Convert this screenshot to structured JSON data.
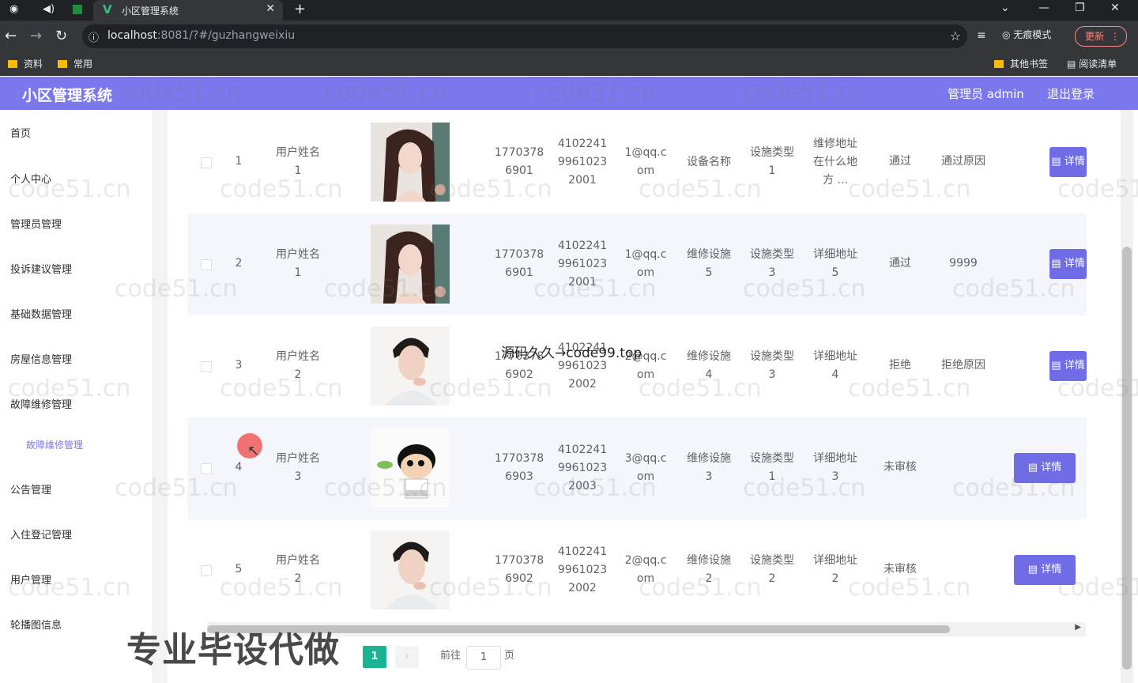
{
  "browser": {
    "tab_title": "小区管理系统",
    "url_host": "localhost",
    "url_path": ":8081/?#/guzhangweixiu",
    "incognito_label": "无痕模式",
    "update_label": "更新",
    "bookmarks": [
      {
        "label": "资料"
      },
      {
        "label": "常用"
      },
      {
        "label": "其他书签"
      },
      {
        "label": "阅读清单"
      }
    ]
  },
  "header": {
    "title": "小区管理系统",
    "user": "管理员 admin",
    "logout": "退出登录",
    "accent_color": "#7b78ee"
  },
  "sidebar": {
    "items": [
      {
        "label": "首页"
      },
      {
        "label": "个人中心"
      },
      {
        "label": "管理员管理"
      },
      {
        "label": "投诉建议管理"
      },
      {
        "label": "基础数据管理"
      },
      {
        "label": "房屋信息管理"
      },
      {
        "label": "故障维修管理"
      },
      {
        "label": "故障维修管理",
        "sub": true,
        "active": true
      },
      {
        "label": "公告管理"
      },
      {
        "label": "入住登记管理"
      },
      {
        "label": "用户管理"
      },
      {
        "label": "轮播图信息"
      }
    ]
  },
  "table": {
    "rows": [
      {
        "index": "1",
        "user_name": [
          "用户姓名",
          "1"
        ],
        "photo": "female-avatar",
        "phone": [
          "1770378",
          "6901"
        ],
        "id_card": [
          "4102241",
          "9961023",
          "2001"
        ],
        "email": [
          "1@qq.c",
          "om"
        ],
        "facility": [
          "设备名称"
        ],
        "facility_type": [
          "设施类型",
          "1"
        ],
        "address": [
          "维修地址",
          "在什么地",
          "方 ..."
        ],
        "status": "通过",
        "reason": "通过原因",
        "action": "详情"
      },
      {
        "index": "2",
        "user_name": [
          "用户姓名",
          "1"
        ],
        "photo": "female-avatar",
        "phone": [
          "1770378",
          "6901"
        ],
        "id_card": [
          "4102241",
          "9961023",
          "2001"
        ],
        "email": [
          "1@qq.c",
          "om"
        ],
        "facility": [
          "维修设施",
          "5"
        ],
        "facility_type": [
          "设施类型",
          "3"
        ],
        "address": [
          "详细地址",
          "5"
        ],
        "status": "通过",
        "reason": "9999",
        "action": "详情"
      },
      {
        "index": "3",
        "user_name": [
          "用户姓名",
          "2"
        ],
        "photo": "male-avatar",
        "phone": [
          "1770378",
          "6902"
        ],
        "id_card": [
          "4102241",
          "9961023",
          "2002"
        ],
        "email": [
          "2@qq.c",
          "om"
        ],
        "facility": [
          "维修设施",
          "4"
        ],
        "facility_type": [
          "设施类型",
          "3"
        ],
        "address": [
          "详细地址",
          "4"
        ],
        "status": "拒绝",
        "reason": "拒绝原因",
        "action": "详情"
      },
      {
        "index": "4",
        "user_name": [
          "用户姓名",
          "3"
        ],
        "photo": "cartoon-avatar",
        "phone": [
          "1770378",
          "6903"
        ],
        "id_card": [
          "4102241",
          "9961023",
          "2003"
        ],
        "email": [
          "3@qq.c",
          "om"
        ],
        "facility": [
          "维修设施",
          "3"
        ],
        "facility_type": [
          "设施类型",
          "1"
        ],
        "address": [
          "详细地址",
          "3"
        ],
        "status": "未审核",
        "reason": "",
        "action": "详情"
      },
      {
        "index": "5",
        "user_name": [
          "用户姓名",
          "2"
        ],
        "photo": "male-avatar",
        "phone": [
          "1770378",
          "6902"
        ],
        "id_card": [
          "4102241",
          "9961023",
          "2002"
        ],
        "email": [
          "2@qq.c",
          "om"
        ],
        "facility": [
          "维修设施",
          "2"
        ],
        "facility_type": [
          "设施类型",
          "2"
        ],
        "address": [
          "详细地址",
          "2"
        ],
        "status": "未审核",
        "reason": "",
        "action": "详情"
      }
    ]
  },
  "pagination": {
    "current_page": "1",
    "goto_prefix": "前往",
    "goto_value": "1",
    "goto_suffix": "页",
    "accent_color": "#1ab394"
  },
  "overlay": {
    "promo_text": "专业毕设代做",
    "center_watermark": "源码久久→code99.top",
    "watermark": "code51.cn"
  }
}
